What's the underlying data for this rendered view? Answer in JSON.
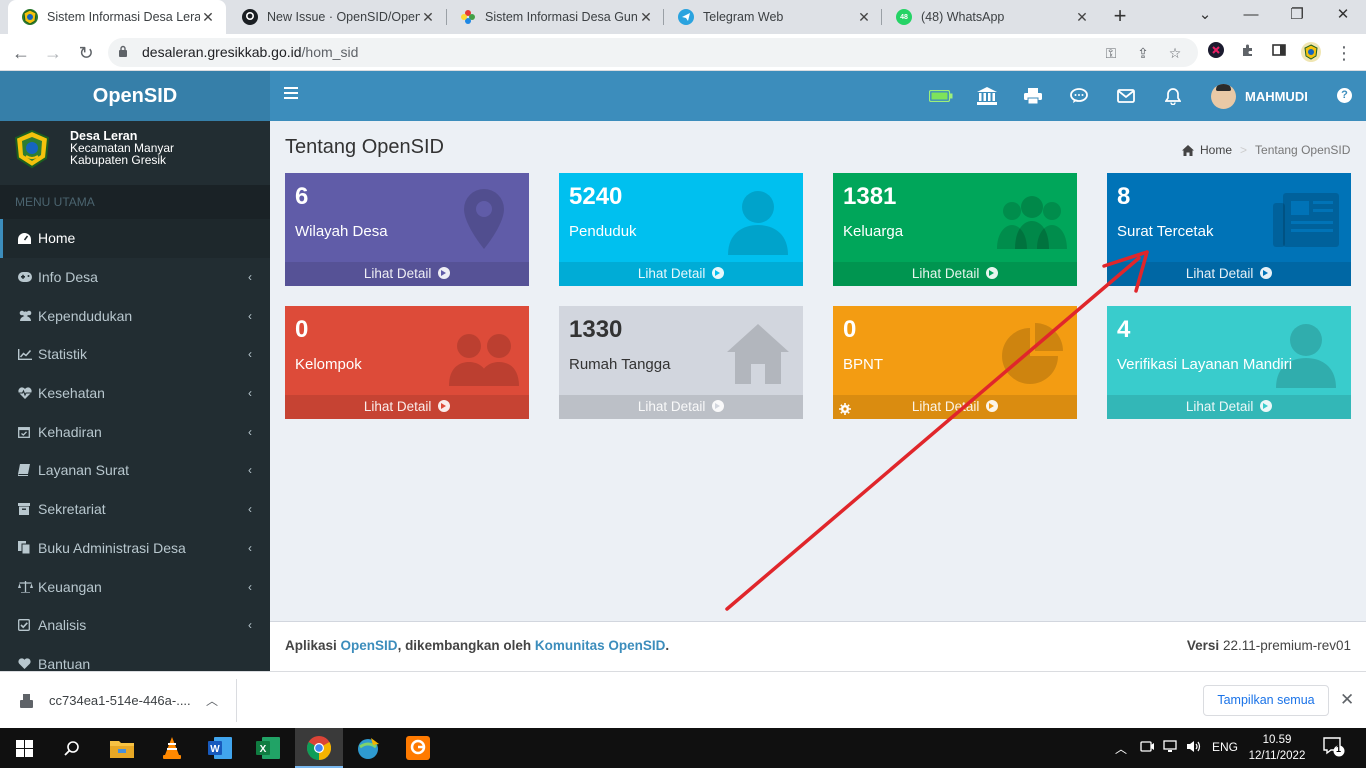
{
  "browser": {
    "tabs": [
      {
        "title": "Sistem Informasi Desa Leran",
        "active": true
      },
      {
        "title": "New Issue · OpenSID/OpenSID",
        "active": false
      },
      {
        "title": "Sistem Informasi Desa Guntur",
        "active": false
      },
      {
        "title": "Telegram Web",
        "active": false
      },
      {
        "title": "(48) WhatsApp",
        "active": false
      }
    ],
    "whatsapp_badge": "48",
    "url_host": "desaleran.gresikkab.go.id",
    "url_path": "/hom_sid"
  },
  "app": {
    "logo": "OpenSID",
    "user": "MAHMUDI",
    "desa_name": "Desa Leran",
    "kecamatan": "Kecamatan Manyar",
    "kabupaten": "Kabupaten Gresik"
  },
  "sidebar": {
    "header": "MENU UTAMA",
    "items": [
      {
        "label": "Home",
        "icon": "dashboard-icon",
        "active": true
      },
      {
        "label": "Info Desa",
        "icon": "gamepad-icon"
      },
      {
        "label": "Kependudukan",
        "icon": "users-icon"
      },
      {
        "label": "Statistik",
        "icon": "line-chart-icon"
      },
      {
        "label": "Kesehatan",
        "icon": "heartbeat-icon"
      },
      {
        "label": "Kehadiran",
        "icon": "calendar-check-icon"
      },
      {
        "label": "Layanan Surat",
        "icon": "book-icon"
      },
      {
        "label": "Sekretariat",
        "icon": "archive-icon"
      },
      {
        "label": "Buku Administrasi Desa",
        "icon": "copy-icon"
      },
      {
        "label": "Keuangan",
        "icon": "balance-scale-icon"
      },
      {
        "label": "Analisis",
        "icon": "check-square-icon"
      },
      {
        "label": "Bantuan",
        "icon": "heart-icon"
      }
    ]
  },
  "content": {
    "title": "Tentang OpenSID",
    "breadcrumb": {
      "home": "Home",
      "current": "Tentang OpenSID"
    },
    "detail_label": "Lihat Detail",
    "boxes": [
      {
        "value": "6",
        "label": "Wilayah Desa",
        "color": "#605ca8",
        "icon": "map-marker-icon"
      },
      {
        "value": "5240",
        "label": "Penduduk",
        "color": "#00c0ef",
        "icon": "user-icon"
      },
      {
        "value": "1381",
        "label": "Keluarga",
        "color": "#00a65a",
        "icon": "users-icon"
      },
      {
        "value": "8",
        "label": "Surat Tercetak",
        "color": "#0073b7",
        "icon": "newspaper-icon"
      },
      {
        "value": "0",
        "label": "Kelompok",
        "color": "#dd4b39",
        "icon": "group-icon"
      },
      {
        "value": "1330",
        "label": "Rumah Tangga",
        "color": "#d2d6de",
        "icon": "home-icon"
      },
      {
        "value": "0",
        "label": "BPNT",
        "color": "#f39c12",
        "icon": "pie-chart-icon"
      },
      {
        "value": "4",
        "label": "Verifikasi Layanan Mandiri",
        "color": "#39cccc",
        "icon": "user-icon"
      }
    ]
  },
  "footer": {
    "prefix": "Aplikasi",
    "opensid": "OpenSID",
    "middle": ", dikembangkan oleh",
    "komunitas": "Komunitas OpenSID",
    "period": ".",
    "versi_label": "Versi",
    "versi_value": "22.11-premium-rev01"
  },
  "downloads": {
    "file": "cc734ea1-514e-446a-....",
    "show_all": "Tampilkan semua"
  },
  "taskbar": {
    "lang": "ENG",
    "time": "10.59",
    "date": "12/11/2022",
    "notif": "1"
  }
}
